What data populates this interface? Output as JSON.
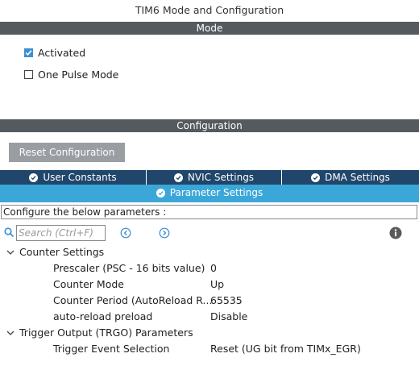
{
  "window_title": "TIM6 Mode and Configuration",
  "mode": {
    "section_label": "Mode",
    "activated": {
      "label": "Activated",
      "checked": true
    },
    "one_pulse": {
      "label": "One Pulse Mode",
      "checked": false
    }
  },
  "configuration": {
    "section_label": "Configuration",
    "reset_button": "Reset Configuration",
    "tabs": [
      {
        "label": "User Constants"
      },
      {
        "label": "NVIC Settings"
      },
      {
        "label": "DMA Settings"
      }
    ],
    "active_tab": "Parameter Settings",
    "info_text": "Configure the below parameters :",
    "search": {
      "placeholder": "Search (Ctrl+F)"
    }
  },
  "parameters": {
    "groups": [
      {
        "title": "Counter Settings",
        "rows": [
          {
            "label": "Prescaler (PSC - 16 bits value)",
            "value": "0"
          },
          {
            "label": "Counter Mode",
            "value": "Up"
          },
          {
            "label": "Counter Period (AutoReload R...",
            "value": "65535"
          },
          {
            "label": "auto-reload preload",
            "value": "Disable"
          }
        ]
      },
      {
        "title": "Trigger Output (TRGO) Parameters",
        "rows": [
          {
            "label": "Trigger Event Selection",
            "value": "Reset (UG bit from TIMx_EGR)"
          }
        ]
      }
    ]
  },
  "colors": {
    "section_bar": "#555a5f",
    "tab_bar": "#21466b",
    "active_tab": "#3ba7d9",
    "checkbox": "#3b8fd4",
    "button": "#9a9ea3"
  }
}
